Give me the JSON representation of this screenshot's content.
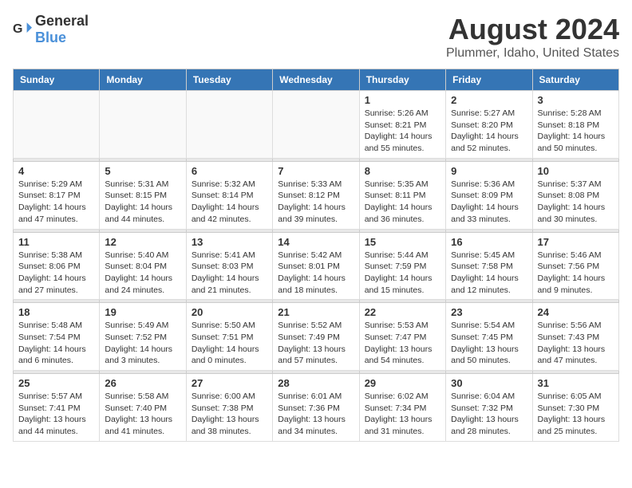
{
  "header": {
    "logo_general": "General",
    "logo_blue": "Blue",
    "month_year": "August 2024",
    "location": "Plummer, Idaho, United States"
  },
  "days_of_week": [
    "Sunday",
    "Monday",
    "Tuesday",
    "Wednesday",
    "Thursday",
    "Friday",
    "Saturday"
  ],
  "weeks": [
    [
      {
        "day": "",
        "info": ""
      },
      {
        "day": "",
        "info": ""
      },
      {
        "day": "",
        "info": ""
      },
      {
        "day": "",
        "info": ""
      },
      {
        "day": "1",
        "info": "Sunrise: 5:26 AM\nSunset: 8:21 PM\nDaylight: 14 hours\nand 55 minutes."
      },
      {
        "day": "2",
        "info": "Sunrise: 5:27 AM\nSunset: 8:20 PM\nDaylight: 14 hours\nand 52 minutes."
      },
      {
        "day": "3",
        "info": "Sunrise: 5:28 AM\nSunset: 8:18 PM\nDaylight: 14 hours\nand 50 minutes."
      }
    ],
    [
      {
        "day": "4",
        "info": "Sunrise: 5:29 AM\nSunset: 8:17 PM\nDaylight: 14 hours\nand 47 minutes."
      },
      {
        "day": "5",
        "info": "Sunrise: 5:31 AM\nSunset: 8:15 PM\nDaylight: 14 hours\nand 44 minutes."
      },
      {
        "day": "6",
        "info": "Sunrise: 5:32 AM\nSunset: 8:14 PM\nDaylight: 14 hours\nand 42 minutes."
      },
      {
        "day": "7",
        "info": "Sunrise: 5:33 AM\nSunset: 8:12 PM\nDaylight: 14 hours\nand 39 minutes."
      },
      {
        "day": "8",
        "info": "Sunrise: 5:35 AM\nSunset: 8:11 PM\nDaylight: 14 hours\nand 36 minutes."
      },
      {
        "day": "9",
        "info": "Sunrise: 5:36 AM\nSunset: 8:09 PM\nDaylight: 14 hours\nand 33 minutes."
      },
      {
        "day": "10",
        "info": "Sunrise: 5:37 AM\nSunset: 8:08 PM\nDaylight: 14 hours\nand 30 minutes."
      }
    ],
    [
      {
        "day": "11",
        "info": "Sunrise: 5:38 AM\nSunset: 8:06 PM\nDaylight: 14 hours\nand 27 minutes."
      },
      {
        "day": "12",
        "info": "Sunrise: 5:40 AM\nSunset: 8:04 PM\nDaylight: 14 hours\nand 24 minutes."
      },
      {
        "day": "13",
        "info": "Sunrise: 5:41 AM\nSunset: 8:03 PM\nDaylight: 14 hours\nand 21 minutes."
      },
      {
        "day": "14",
        "info": "Sunrise: 5:42 AM\nSunset: 8:01 PM\nDaylight: 14 hours\nand 18 minutes."
      },
      {
        "day": "15",
        "info": "Sunrise: 5:44 AM\nSunset: 7:59 PM\nDaylight: 14 hours\nand 15 minutes."
      },
      {
        "day": "16",
        "info": "Sunrise: 5:45 AM\nSunset: 7:58 PM\nDaylight: 14 hours\nand 12 minutes."
      },
      {
        "day": "17",
        "info": "Sunrise: 5:46 AM\nSunset: 7:56 PM\nDaylight: 14 hours\nand 9 minutes."
      }
    ],
    [
      {
        "day": "18",
        "info": "Sunrise: 5:48 AM\nSunset: 7:54 PM\nDaylight: 14 hours\nand 6 minutes."
      },
      {
        "day": "19",
        "info": "Sunrise: 5:49 AM\nSunset: 7:52 PM\nDaylight: 14 hours\nand 3 minutes."
      },
      {
        "day": "20",
        "info": "Sunrise: 5:50 AM\nSunset: 7:51 PM\nDaylight: 14 hours\nand 0 minutes."
      },
      {
        "day": "21",
        "info": "Sunrise: 5:52 AM\nSunset: 7:49 PM\nDaylight: 13 hours\nand 57 minutes."
      },
      {
        "day": "22",
        "info": "Sunrise: 5:53 AM\nSunset: 7:47 PM\nDaylight: 13 hours\nand 54 minutes."
      },
      {
        "day": "23",
        "info": "Sunrise: 5:54 AM\nSunset: 7:45 PM\nDaylight: 13 hours\nand 50 minutes."
      },
      {
        "day": "24",
        "info": "Sunrise: 5:56 AM\nSunset: 7:43 PM\nDaylight: 13 hours\nand 47 minutes."
      }
    ],
    [
      {
        "day": "25",
        "info": "Sunrise: 5:57 AM\nSunset: 7:41 PM\nDaylight: 13 hours\nand 44 minutes."
      },
      {
        "day": "26",
        "info": "Sunrise: 5:58 AM\nSunset: 7:40 PM\nDaylight: 13 hours\nand 41 minutes."
      },
      {
        "day": "27",
        "info": "Sunrise: 6:00 AM\nSunset: 7:38 PM\nDaylight: 13 hours\nand 38 minutes."
      },
      {
        "day": "28",
        "info": "Sunrise: 6:01 AM\nSunset: 7:36 PM\nDaylight: 13 hours\nand 34 minutes."
      },
      {
        "day": "29",
        "info": "Sunrise: 6:02 AM\nSunset: 7:34 PM\nDaylight: 13 hours\nand 31 minutes."
      },
      {
        "day": "30",
        "info": "Sunrise: 6:04 AM\nSunset: 7:32 PM\nDaylight: 13 hours\nand 28 minutes."
      },
      {
        "day": "31",
        "info": "Sunrise: 6:05 AM\nSunset: 7:30 PM\nDaylight: 13 hours\nand 25 minutes."
      }
    ]
  ]
}
